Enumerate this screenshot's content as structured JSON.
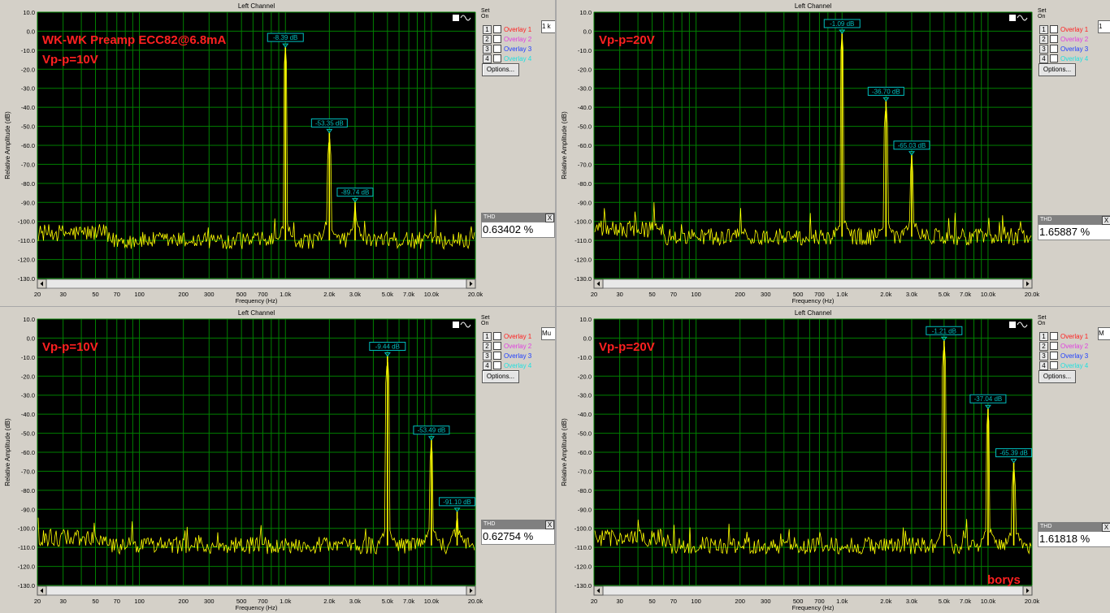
{
  "chart_data": [
    {
      "type": "line",
      "title": "Left Channel",
      "xlabel": "Frequency (Hz)",
      "ylabel": "Relative Amplitude (dB)",
      "xscale": "log",
      "xlim": [
        20,
        20000
      ],
      "ylim": [
        -130,
        10
      ],
      "yticks": [
        "10.0",
        "0.0",
        "-10.0",
        "-20.0",
        "-30.0",
        "-40.0",
        "-50.0",
        "-60.0",
        "-70.0",
        "-80.0",
        "-90.0",
        "-100.0",
        "-110.0",
        "-120.0",
        "-130.0"
      ],
      "xticks": [
        {
          "v": 20,
          "l": "20"
        },
        {
          "v": 30,
          "l": "30"
        },
        {
          "v": 50,
          "l": "50"
        },
        {
          "v": 70,
          "l": "70"
        },
        {
          "v": 100,
          "l": "100"
        },
        {
          "v": 200,
          "l": "200"
        },
        {
          "v": 300,
          "l": "300"
        },
        {
          "v": 500,
          "l": "500"
        },
        {
          "v": 700,
          "l": "700"
        },
        {
          "v": 1000,
          "l": "1.0k"
        },
        {
          "v": 2000,
          "l": "2.0k"
        },
        {
          "v": 3000,
          "l": "3.0k"
        },
        {
          "v": 5000,
          "l": "5.0k"
        },
        {
          "v": 7000,
          "l": "7.0k"
        },
        {
          "v": 10000,
          "l": "10.0k"
        },
        {
          "v": 20000,
          "l": "20.0k"
        }
      ],
      "annotation_lines": [
        "WK-WK Preamp  ECC82@6.8mA",
        "Vp-p=10V"
      ],
      "noise_floor": -110,
      "peaks": [
        {
          "freq": 1000,
          "db": -8.39,
          "label": "-8.39 dB"
        },
        {
          "freq": 2000,
          "db": -53.35,
          "label": "-53.35 dB"
        },
        {
          "freq": 3000,
          "db": -89.74,
          "label": "-89.74 dB"
        }
      ],
      "thd": "0.63402 %",
      "edge_text": "1 k"
    },
    {
      "type": "line",
      "title": "Left Channel",
      "xlabel": "Frequency (Hz)",
      "ylabel": "Relative Amplitude (dB)",
      "xscale": "log",
      "xlim": [
        20,
        20000
      ],
      "ylim": [
        -130,
        10
      ],
      "yticks": [
        "10.0",
        "0.0",
        "-10.0",
        "-20.0",
        "-30.0",
        "-40.0",
        "-50.0",
        "-60.0",
        "-70.0",
        "-80.0",
        "-90.0",
        "-100.0",
        "-110.0",
        "-120.0",
        "-130.0"
      ],
      "xticks": [
        {
          "v": 20,
          "l": "20"
        },
        {
          "v": 30,
          "l": "30"
        },
        {
          "v": 50,
          "l": "50"
        },
        {
          "v": 70,
          "l": "70"
        },
        {
          "v": 100,
          "l": "100"
        },
        {
          "v": 200,
          "l": "200"
        },
        {
          "v": 300,
          "l": "300"
        },
        {
          "v": 500,
          "l": "500"
        },
        {
          "v": 700,
          "l": "700"
        },
        {
          "v": 1000,
          "l": "1.0k"
        },
        {
          "v": 2000,
          "l": "2.0k"
        },
        {
          "v": 3000,
          "l": "3.0k"
        },
        {
          "v": 5000,
          "l": "5.0k"
        },
        {
          "v": 7000,
          "l": "7.0k"
        },
        {
          "v": 10000,
          "l": "10.0k"
        },
        {
          "v": 20000,
          "l": "20.0k"
        }
      ],
      "annotation_lines": [
        "Vp-p=20V"
      ],
      "noise_floor": -108,
      "peaks": [
        {
          "freq": 1000,
          "db": -1.09,
          "label": "-1.09 dB"
        },
        {
          "freq": 2000,
          "db": -36.7,
          "label": "-36.70 dB"
        },
        {
          "freq": 3000,
          "db": -65.03,
          "label": "-65.03 dB"
        }
      ],
      "thd": "1.65887 %",
      "edge_text": "1"
    },
    {
      "type": "line",
      "title": "Left Channel",
      "xlabel": "Frequency (Hz)",
      "ylabel": "Relative Amplitude (dB)",
      "xscale": "log",
      "xlim": [
        20,
        20000
      ],
      "ylim": [
        -130,
        10
      ],
      "yticks": [
        "10.0",
        "0.0",
        "-10.0",
        "-20.0",
        "-30.0",
        "-40.0",
        "-50.0",
        "-60.0",
        "-70.0",
        "-80.0",
        "-90.0",
        "-100.0",
        "-110.0",
        "-120.0",
        "-130.0"
      ],
      "xticks": [
        {
          "v": 20,
          "l": "20"
        },
        {
          "v": 30,
          "l": "30"
        },
        {
          "v": 50,
          "l": "50"
        },
        {
          "v": 70,
          "l": "70"
        },
        {
          "v": 100,
          "l": "100"
        },
        {
          "v": 200,
          "l": "200"
        },
        {
          "v": 300,
          "l": "300"
        },
        {
          "v": 500,
          "l": "500"
        },
        {
          "v": 700,
          "l": "700"
        },
        {
          "v": 1000,
          "l": "1.0k"
        },
        {
          "v": 2000,
          "l": "2.0k"
        },
        {
          "v": 3000,
          "l": "3.0k"
        },
        {
          "v": 5000,
          "l": "5.0k"
        },
        {
          "v": 7000,
          "l": "7.0k"
        },
        {
          "v": 10000,
          "l": "10.0k"
        },
        {
          "v": 20000,
          "l": "20.0k"
        }
      ],
      "annotation_lines": [
        "Vp-p=10V"
      ],
      "noise_floor": -109,
      "peaks": [
        {
          "freq": 5000,
          "db": -9.44,
          "label": "-9.44 dB"
        },
        {
          "freq": 10000,
          "db": -53.49,
          "label": "-53.49 dB"
        },
        {
          "freq": 15000,
          "db": -91.1,
          "label": "-91.10 dB"
        }
      ],
      "thd": "0.62754 %",
      "edge_text": "Mu"
    },
    {
      "type": "line",
      "title": "Left Channel",
      "xlabel": "Frequency (Hz)",
      "ylabel": "Relative Amplitude (dB)",
      "xscale": "log",
      "xlim": [
        20,
        20000
      ],
      "ylim": [
        -130,
        10
      ],
      "yticks": [
        "10.0",
        "0.0",
        "-10.0",
        "-20.0",
        "-30.0",
        "-40.0",
        "-50.0",
        "-60.0",
        "-70.0",
        "-80.0",
        "-90.0",
        "-100.0",
        "-110.0",
        "-120.0",
        "-130.0"
      ],
      "xticks": [
        {
          "v": 20,
          "l": "20"
        },
        {
          "v": 30,
          "l": "30"
        },
        {
          "v": 50,
          "l": "50"
        },
        {
          "v": 70,
          "l": "70"
        },
        {
          "v": 100,
          "l": "100"
        },
        {
          "v": 200,
          "l": "200"
        },
        {
          "v": 300,
          "l": "300"
        },
        {
          "v": 500,
          "l": "500"
        },
        {
          "v": 700,
          "l": "700"
        },
        {
          "v": 1000,
          "l": "1.0k"
        },
        {
          "v": 2000,
          "l": "2.0k"
        },
        {
          "v": 3000,
          "l": "3.0k"
        },
        {
          "v": 5000,
          "l": "5.0k"
        },
        {
          "v": 7000,
          "l": "7.0k"
        },
        {
          "v": 10000,
          "l": "10.0k"
        },
        {
          "v": 20000,
          "l": "20.0k"
        }
      ],
      "annotation_lines": [
        "Vp-p=20V"
      ],
      "signature": "borys",
      "noise_floor": -109,
      "peaks": [
        {
          "freq": 5000,
          "db": -1.21,
          "label": "-1.21 dB"
        },
        {
          "freq": 10000,
          "db": -37.04,
          "label": "-37.04 dB"
        },
        {
          "freq": 15000,
          "db": -65.39,
          "label": "-65.39 dB"
        }
      ],
      "thd": "1.61818 %",
      "edge_text": "M"
    }
  ],
  "overlays": {
    "title": "Overlays",
    "set_label": "Set",
    "on_label": "On",
    "items": [
      {
        "num": "1",
        "label": "Overlay 1",
        "color": "#ff2020"
      },
      {
        "num": "2",
        "label": "Overlay 2",
        "color": "#e040e0"
      },
      {
        "num": "3",
        "label": "Overlay 3",
        "color": "#2040ff"
      },
      {
        "num": "4",
        "label": "Overlay 4",
        "color": "#20e0e0"
      }
    ],
    "options_label": "Options..."
  },
  "thd_title": "THD",
  "close_glyph": "X",
  "colors": {
    "trace": "#ffff00",
    "grid": "#008000",
    "marker": "#00c0c0",
    "annotation": "#ff2020",
    "plot_bg": "#000000"
  }
}
